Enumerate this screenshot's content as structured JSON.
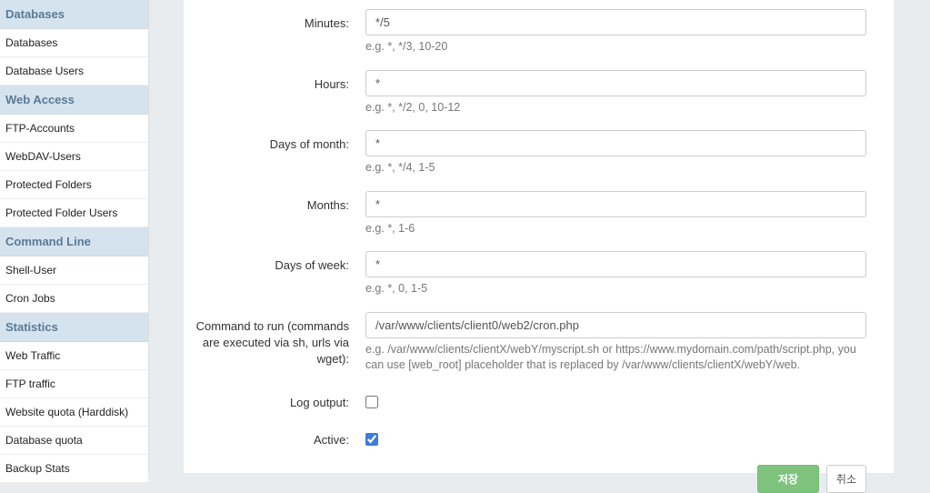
{
  "sidebar": {
    "groups": [
      {
        "header": "Databases",
        "items": [
          "Databases",
          "Database Users"
        ]
      },
      {
        "header": "Web Access",
        "items": [
          "FTP-Accounts",
          "WebDAV-Users",
          "Protected Folders",
          "Protected Folder Users"
        ]
      },
      {
        "header": "Command Line",
        "items": [
          "Shell-User",
          "Cron Jobs"
        ]
      },
      {
        "header": "Statistics",
        "items": [
          "Web Traffic",
          "FTP traffic",
          "Website quota (Harddisk)",
          "Database quota",
          "Backup Stats"
        ]
      }
    ]
  },
  "form": {
    "minutes": {
      "label": "Minutes:",
      "value": "*/5",
      "hint": "e.g. *, */3, 10-20"
    },
    "hours": {
      "label": "Hours:",
      "value": "*",
      "hint": "e.g. *, */2, 0, 10-12"
    },
    "dom": {
      "label": "Days of month:",
      "value": "*",
      "hint": "e.g. *, */4, 1-5"
    },
    "months": {
      "label": "Months:",
      "value": "*",
      "hint": "e.g. *, 1-6"
    },
    "dow": {
      "label": "Days of week:",
      "value": "*",
      "hint": "e.g. *, 0, 1-5"
    },
    "command": {
      "label": "Command to run (commands are executed via sh, urls via wget):",
      "value": "/var/www/clients/client0/web2/cron.php",
      "hint": "e.g. /var/www/clients/clientX/webY/myscript.sh or https://www.mydomain.com/path/script.php, you can use [web_root] placeholder that is replaced by /var/www/clients/clientX/webY/web."
    },
    "log": {
      "label": "Log output:",
      "checked": false
    },
    "active": {
      "label": "Active:",
      "checked": true
    }
  },
  "buttons": {
    "save": "저장",
    "cancel": "취소"
  }
}
